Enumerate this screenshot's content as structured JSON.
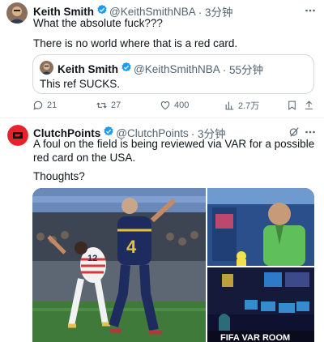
{
  "tweet1": {
    "name": "Keith Smith",
    "handle": "@KeithSmithNBA",
    "time": "· 3分钟",
    "line1": "What the absolute fuck???",
    "line2": "There is no world where that is a red card.",
    "quote": {
      "name": "Keith Smith",
      "handle": "@KeithSmithNBA",
      "time": "· 55分钟",
      "text": "This ref SUCKS."
    },
    "actions": {
      "replies": "21",
      "retweets": "27",
      "likes": "400",
      "views": "2.7万"
    }
  },
  "tweet2": {
    "name": "ClutchPoints",
    "handle": "@ClutchPoints",
    "time": "· 3分钟",
    "text": "A foul on the field is being reviewed via VAR for a possible red card on the USA.",
    "text2": "Thoughts?",
    "media": {
      "jersey_number": "4",
      "jersey_number_2": "12",
      "banner_text": "FIFA VAR ROOM"
    }
  },
  "colors": {
    "verified": "#1d9bf0",
    "secondary_text": "#536471",
    "clutch_red": "#e8222b"
  }
}
